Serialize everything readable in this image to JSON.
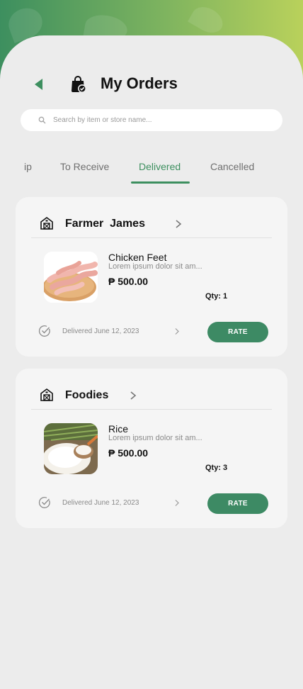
{
  "header": {
    "title": "My Orders",
    "back_icon": "back-arrow-icon",
    "title_icon": "shopping-bag-check-icon"
  },
  "search": {
    "placeholder": "Search by item or store name..."
  },
  "tabs": [
    {
      "label": "ip",
      "active": false
    },
    {
      "label": "To Receive",
      "active": false
    },
    {
      "label": "Delivered",
      "active": true
    },
    {
      "label": "Cancelled",
      "active": false
    }
  ],
  "orders": [
    {
      "store": "Farmer  James",
      "item_name": "Chicken Feet",
      "item_desc": "Lorem ipsum dolor sit am...",
      "price": "₱ 500.00",
      "qty": "Qty: 1",
      "delivered": "Delivered June 12, 2023",
      "action": "RATE"
    },
    {
      "store": "Foodies",
      "item_name": "Rice",
      "item_desc": "Lorem ipsum dolor sit am...",
      "price": "₱ 500.00",
      "qty": "Qty: 3",
      "delivered": "Delivered June 12, 2023",
      "action": "RATE"
    }
  ],
  "colors": {
    "accent": "#3d8f5f",
    "button": "#3d8a64",
    "gradient_end": "#b9d15b",
    "background": "#ececec",
    "card": "#f5f5f5"
  }
}
